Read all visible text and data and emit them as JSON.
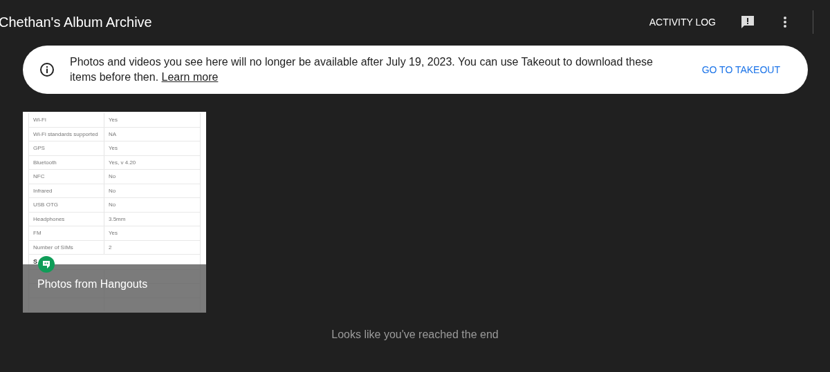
{
  "header": {
    "title": "Chethan's Album Archive",
    "actions": [
      {
        "kind": "text",
        "label": "ACTIVITY LOG"
      },
      {
        "kind": "feedback"
      },
      {
        "kind": "more"
      }
    ]
  },
  "banner": {
    "message": "Photos and videos you see here will no longer be available after July 19, 2023. You can use Takeout to download these items before then.",
    "link": "Learn more",
    "action": "GO TO TAKEOUT"
  },
  "albums": [
    {
      "title": "Photos from Hangouts",
      "thumbnail": {
        "rows": [
          {
            "kind": "pair",
            "label": "Wi-Fi",
            "value": "Yes"
          },
          {
            "kind": "pair",
            "label": "Wi-Fi standards supported",
            "value": "NA"
          },
          {
            "kind": "pair",
            "label": "GPS",
            "value": "Yes"
          },
          {
            "kind": "pair",
            "label": "Bluetooth",
            "value": "Yes, v 4.20"
          },
          {
            "kind": "pair",
            "label": "NFC",
            "value": "No"
          },
          {
            "kind": "pair",
            "label": "Infrared",
            "value": "No"
          },
          {
            "kind": "pair",
            "label": "USB OTG",
            "value": "No"
          },
          {
            "kind": "pair",
            "label": "Headphones",
            "value": "3.5mm"
          },
          {
            "kind": "pair",
            "label": "FM",
            "value": "Yes"
          },
          {
            "kind": "pair",
            "label": "Number of SIMs",
            "value": "2"
          },
          {
            "kind": "section",
            "label": "S"
          }
        ]
      }
    }
  ],
  "end_message": "Looks like you've reached the end"
}
